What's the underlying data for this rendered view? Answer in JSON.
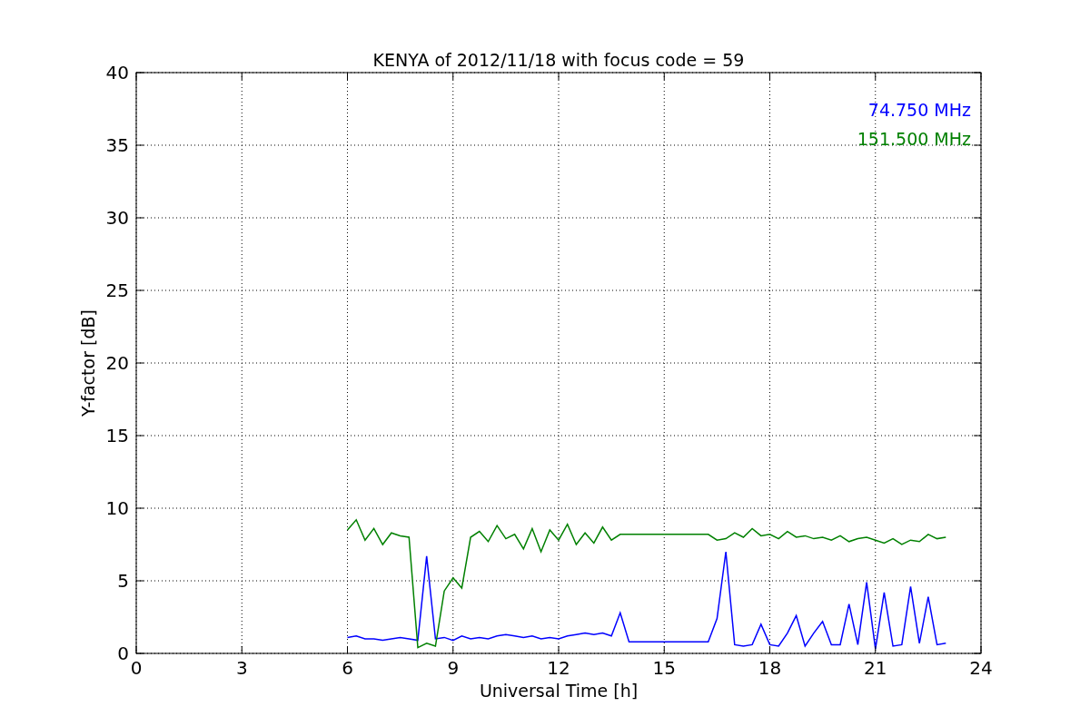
{
  "figure": {
    "chart_data": {
      "type": "line",
      "title": "KENYA of 2012/11/18 with focus code = 59",
      "xlabel": "Universal Time [h]",
      "ylabel": "Y-factor [dB]",
      "grid": true,
      "xlim": [
        0,
        24
      ],
      "ylim": [
        0,
        40
      ],
      "xticks": [
        0,
        3,
        6,
        9,
        12,
        15,
        18,
        21,
        24
      ],
      "yticks": [
        0,
        5,
        10,
        15,
        20,
        25,
        30,
        35,
        40
      ],
      "x": [
        6,
        6.25,
        6.5,
        6.75,
        7,
        7.25,
        7.5,
        7.75,
        8,
        8.25,
        8.5,
        8.75,
        9,
        9.25,
        9.5,
        9.75,
        10,
        10.25,
        10.5,
        10.75,
        11,
        11.25,
        11.5,
        11.75,
        12,
        12.25,
        12.5,
        12.75,
        13,
        13.25,
        13.5,
        13.75,
        14,
        14.25,
        14.5,
        14.75,
        15,
        15.25,
        15.5,
        15.75,
        16,
        16.25,
        16.5,
        16.75,
        17,
        17.25,
        17.5,
        17.75,
        18,
        18.25,
        18.5,
        18.75,
        19,
        19.25,
        19.5,
        19.75,
        20,
        20.25,
        20.5,
        20.75,
        21,
        21.25,
        21.5,
        21.75,
        22,
        22.25,
        22.5,
        22.75,
        23
      ],
      "series": [
        {
          "name": "74.750 MHz",
          "color": "#0000ff",
          "values": [
            1.1,
            1.2,
            1.0,
            1.0,
            0.9,
            1.0,
            1.1,
            1.0,
            0.9,
            6.7,
            1.0,
            1.1,
            0.9,
            1.2,
            1.0,
            1.1,
            1.0,
            1.2,
            1.3,
            1.2,
            1.1,
            1.2,
            1.0,
            1.1,
            1.0,
            1.2,
            1.3,
            1.4,
            1.3,
            1.4,
            1.2,
            2.8,
            0.8,
            0.8,
            0.8,
            0.8,
            0.8,
            0.8,
            0.8,
            0.8,
            0.8,
            0.8,
            2.4,
            7.0,
            0.6,
            0.5,
            0.6,
            2.0,
            0.6,
            0.5,
            1.4,
            2.6,
            0.5,
            1.4,
            2.2,
            0.6,
            0.6,
            3.4,
            0.6,
            4.9,
            0.3,
            4.2,
            0.5,
            0.6,
            4.6,
            0.7,
            3.9,
            0.6,
            0.7
          ]
        },
        {
          "name": "151.500 MHz",
          "color": "#008000",
          "values": [
            8.5,
            9.2,
            7.8,
            8.6,
            7.5,
            8.3,
            8.1,
            8.0,
            0.4,
            0.7,
            0.5,
            4.3,
            5.2,
            4.5,
            8.0,
            8.4,
            7.7,
            8.8,
            7.9,
            8.2,
            7.2,
            8.6,
            7.0,
            8.5,
            7.8,
            8.9,
            7.5,
            8.3,
            7.6,
            8.7,
            7.8,
            8.2,
            8.2,
            8.2,
            8.2,
            8.2,
            8.2,
            8.2,
            8.2,
            8.2,
            8.2,
            8.2,
            7.8,
            7.9,
            8.3,
            8.0,
            8.6,
            8.1,
            8.2,
            7.9,
            8.4,
            8.0,
            8.1,
            7.9,
            8.0,
            7.8,
            8.1,
            7.7,
            7.9,
            8.0,
            7.8,
            7.6,
            7.9,
            7.5,
            7.8,
            7.7,
            8.2,
            7.9,
            8.0
          ]
        }
      ]
    }
  }
}
